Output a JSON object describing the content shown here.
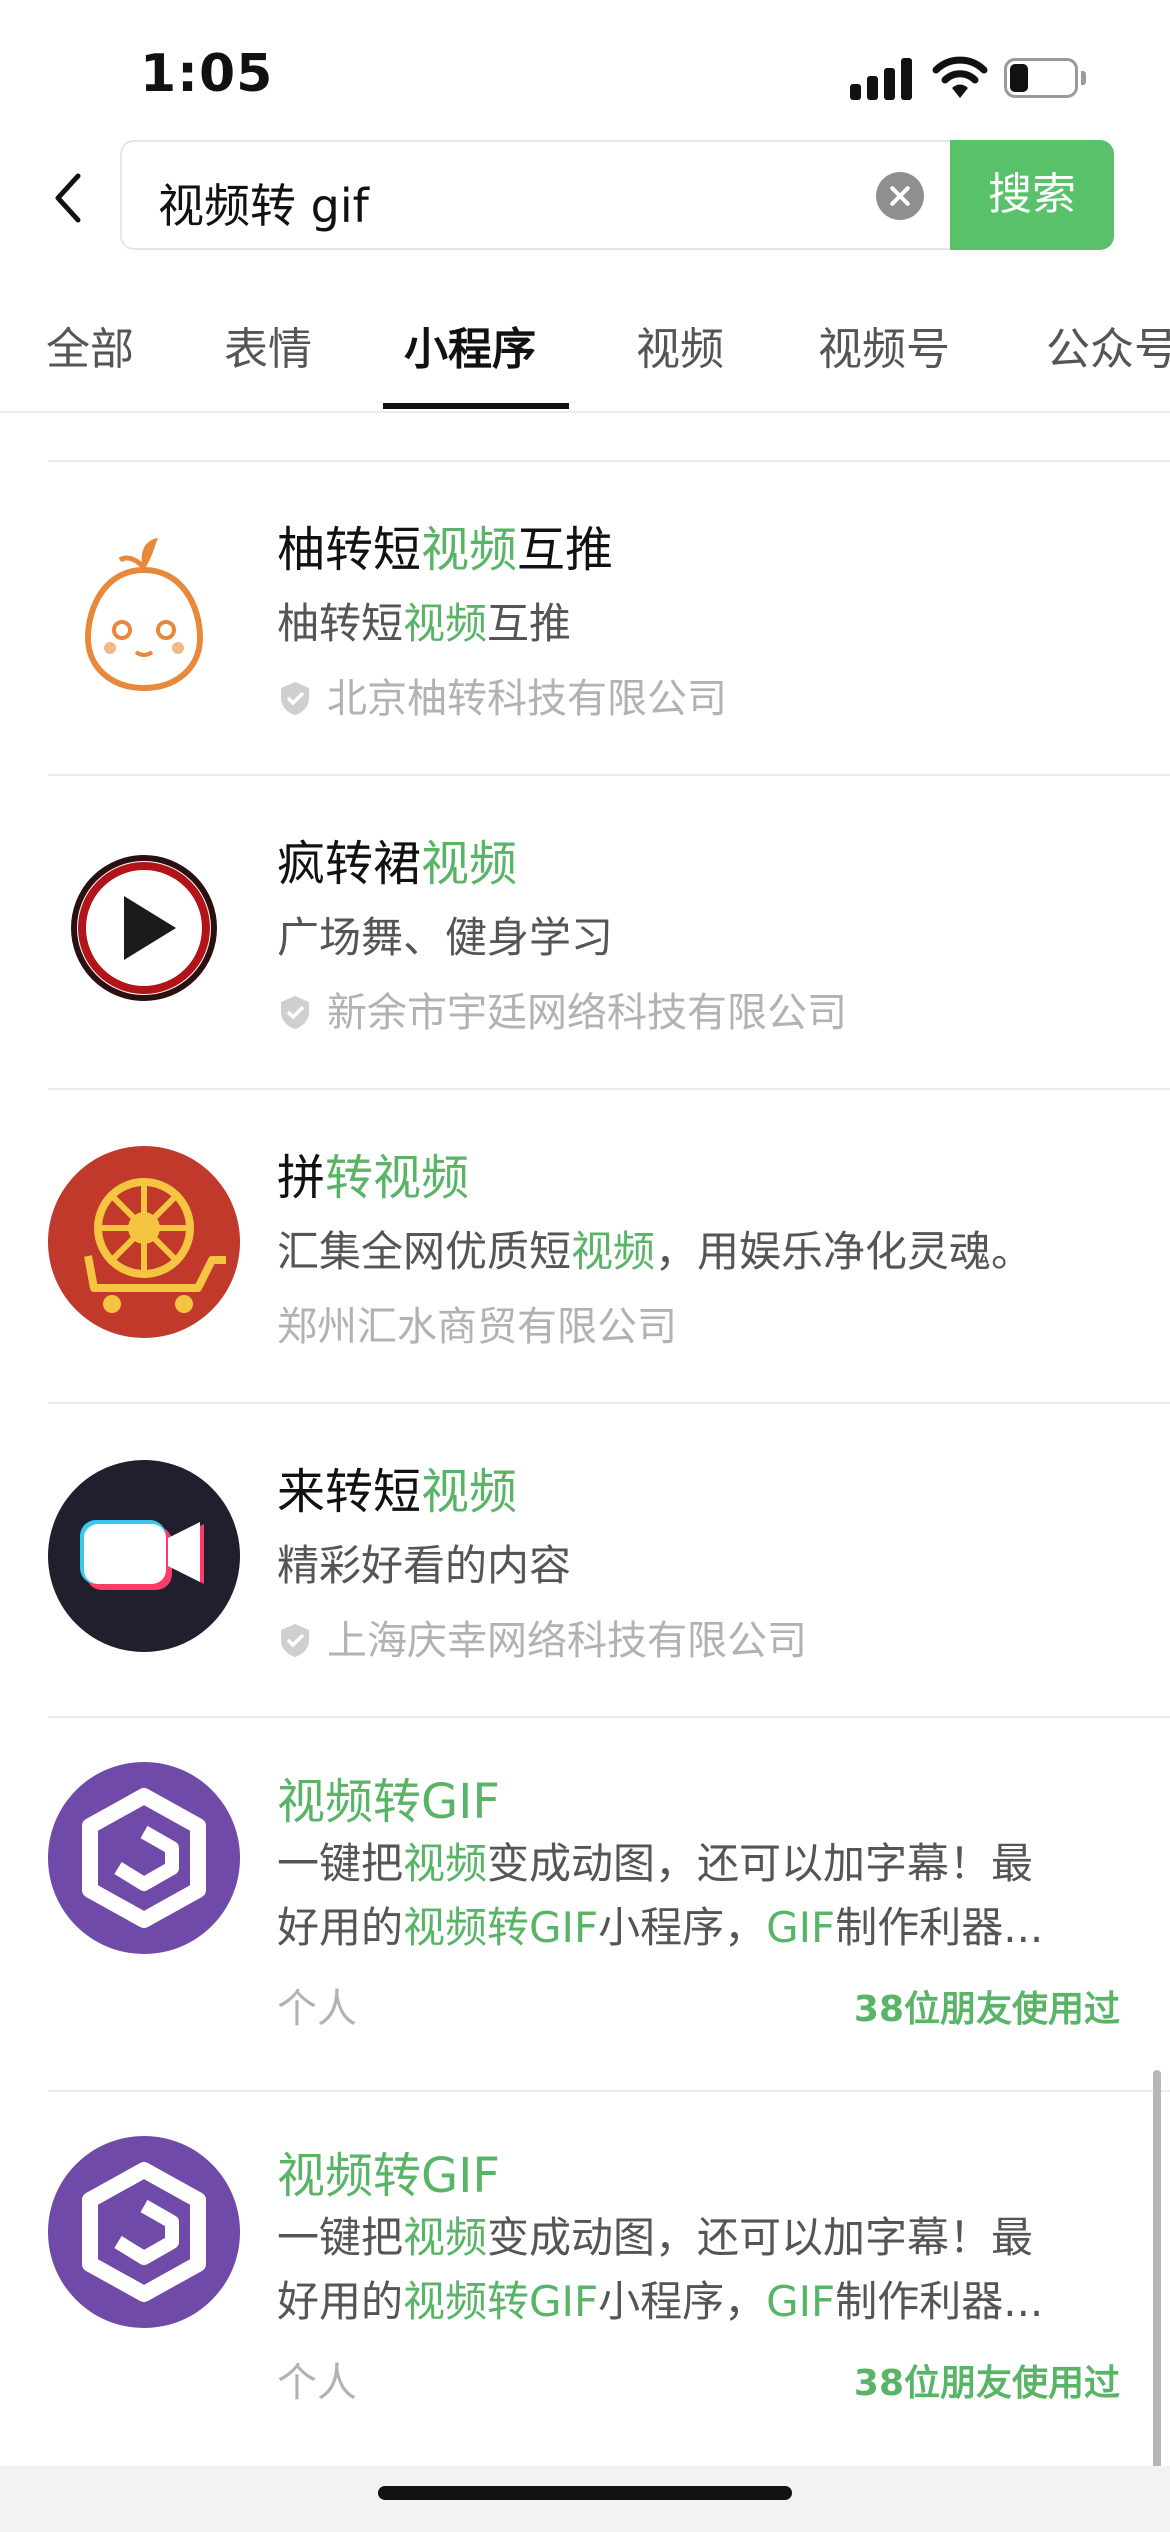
{
  "status_bar": {
    "time": "1:05"
  },
  "search": {
    "query": "视频转 gif",
    "button_label": "搜索"
  },
  "tabs": [
    {
      "label": "全部"
    },
    {
      "label": "表情"
    },
    {
      "label": "小程序"
    },
    {
      "label": "视频"
    },
    {
      "label": "视频号"
    },
    {
      "label": "公众号"
    }
  ],
  "active_tab": "小程序",
  "results": [
    {
      "title_pre": "柚转短",
      "title_hl": "视频",
      "title_post": "互推",
      "desc_pre": "柚转短",
      "desc_hl": "视频",
      "desc_post": "互推",
      "company": "北京柚转科技有限公司",
      "verified": true
    },
    {
      "title_pre": "疯转裙",
      "title_hl": "视频",
      "title_post": "",
      "desc": "广场舞、健身学习",
      "company": "新余市宇廷网络科技有限公司",
      "verified": true
    },
    {
      "title_pre": "拼",
      "title_hl": "转视频",
      "title_post": "",
      "desc_pre": "汇集全网优质短",
      "desc_hl": "视频",
      "desc_post": "，用娱乐净化灵魂。",
      "company": "郑州汇水商贸有限公司",
      "verified": false
    },
    {
      "title_pre": "来转短",
      "title_hl": "视频",
      "title_post": "",
      "desc": "精彩好看的内容",
      "company": "上海庆幸网络科技有限公司",
      "verified": true
    },
    {
      "title": "视频转GIF",
      "line1_a": "一键把",
      "line1_hl": "视频",
      "line1_b": "变成动图，还可以加字幕！最",
      "line2_a": "好用的",
      "line2_hl1": "视频转GIF",
      "line2_b": "小程序，",
      "line2_hl2": "GIF",
      "line2_c": "制作利器...",
      "owner": "个人",
      "friends": "38位朋友使用过"
    },
    {
      "title": "视频转GIF",
      "line1_a": "一键把",
      "line1_hl": "视频",
      "line1_b": "变成动图，还可以加字幕！最",
      "line2_a": "好用的",
      "line2_hl1": "视频转GIF",
      "line2_b": "小程序，",
      "line2_hl2": "GIF",
      "line2_c": "制作利器...",
      "owner": "个人",
      "friends": "38位朋友使用过"
    }
  ],
  "colors": {
    "accent": "#5ab467",
    "search_button": "#5ac16b"
  },
  "icons": [
    "back-chevron-icon",
    "clear-icon",
    "verified-icon",
    "signal-icon",
    "wifi-icon",
    "battery-icon"
  ]
}
